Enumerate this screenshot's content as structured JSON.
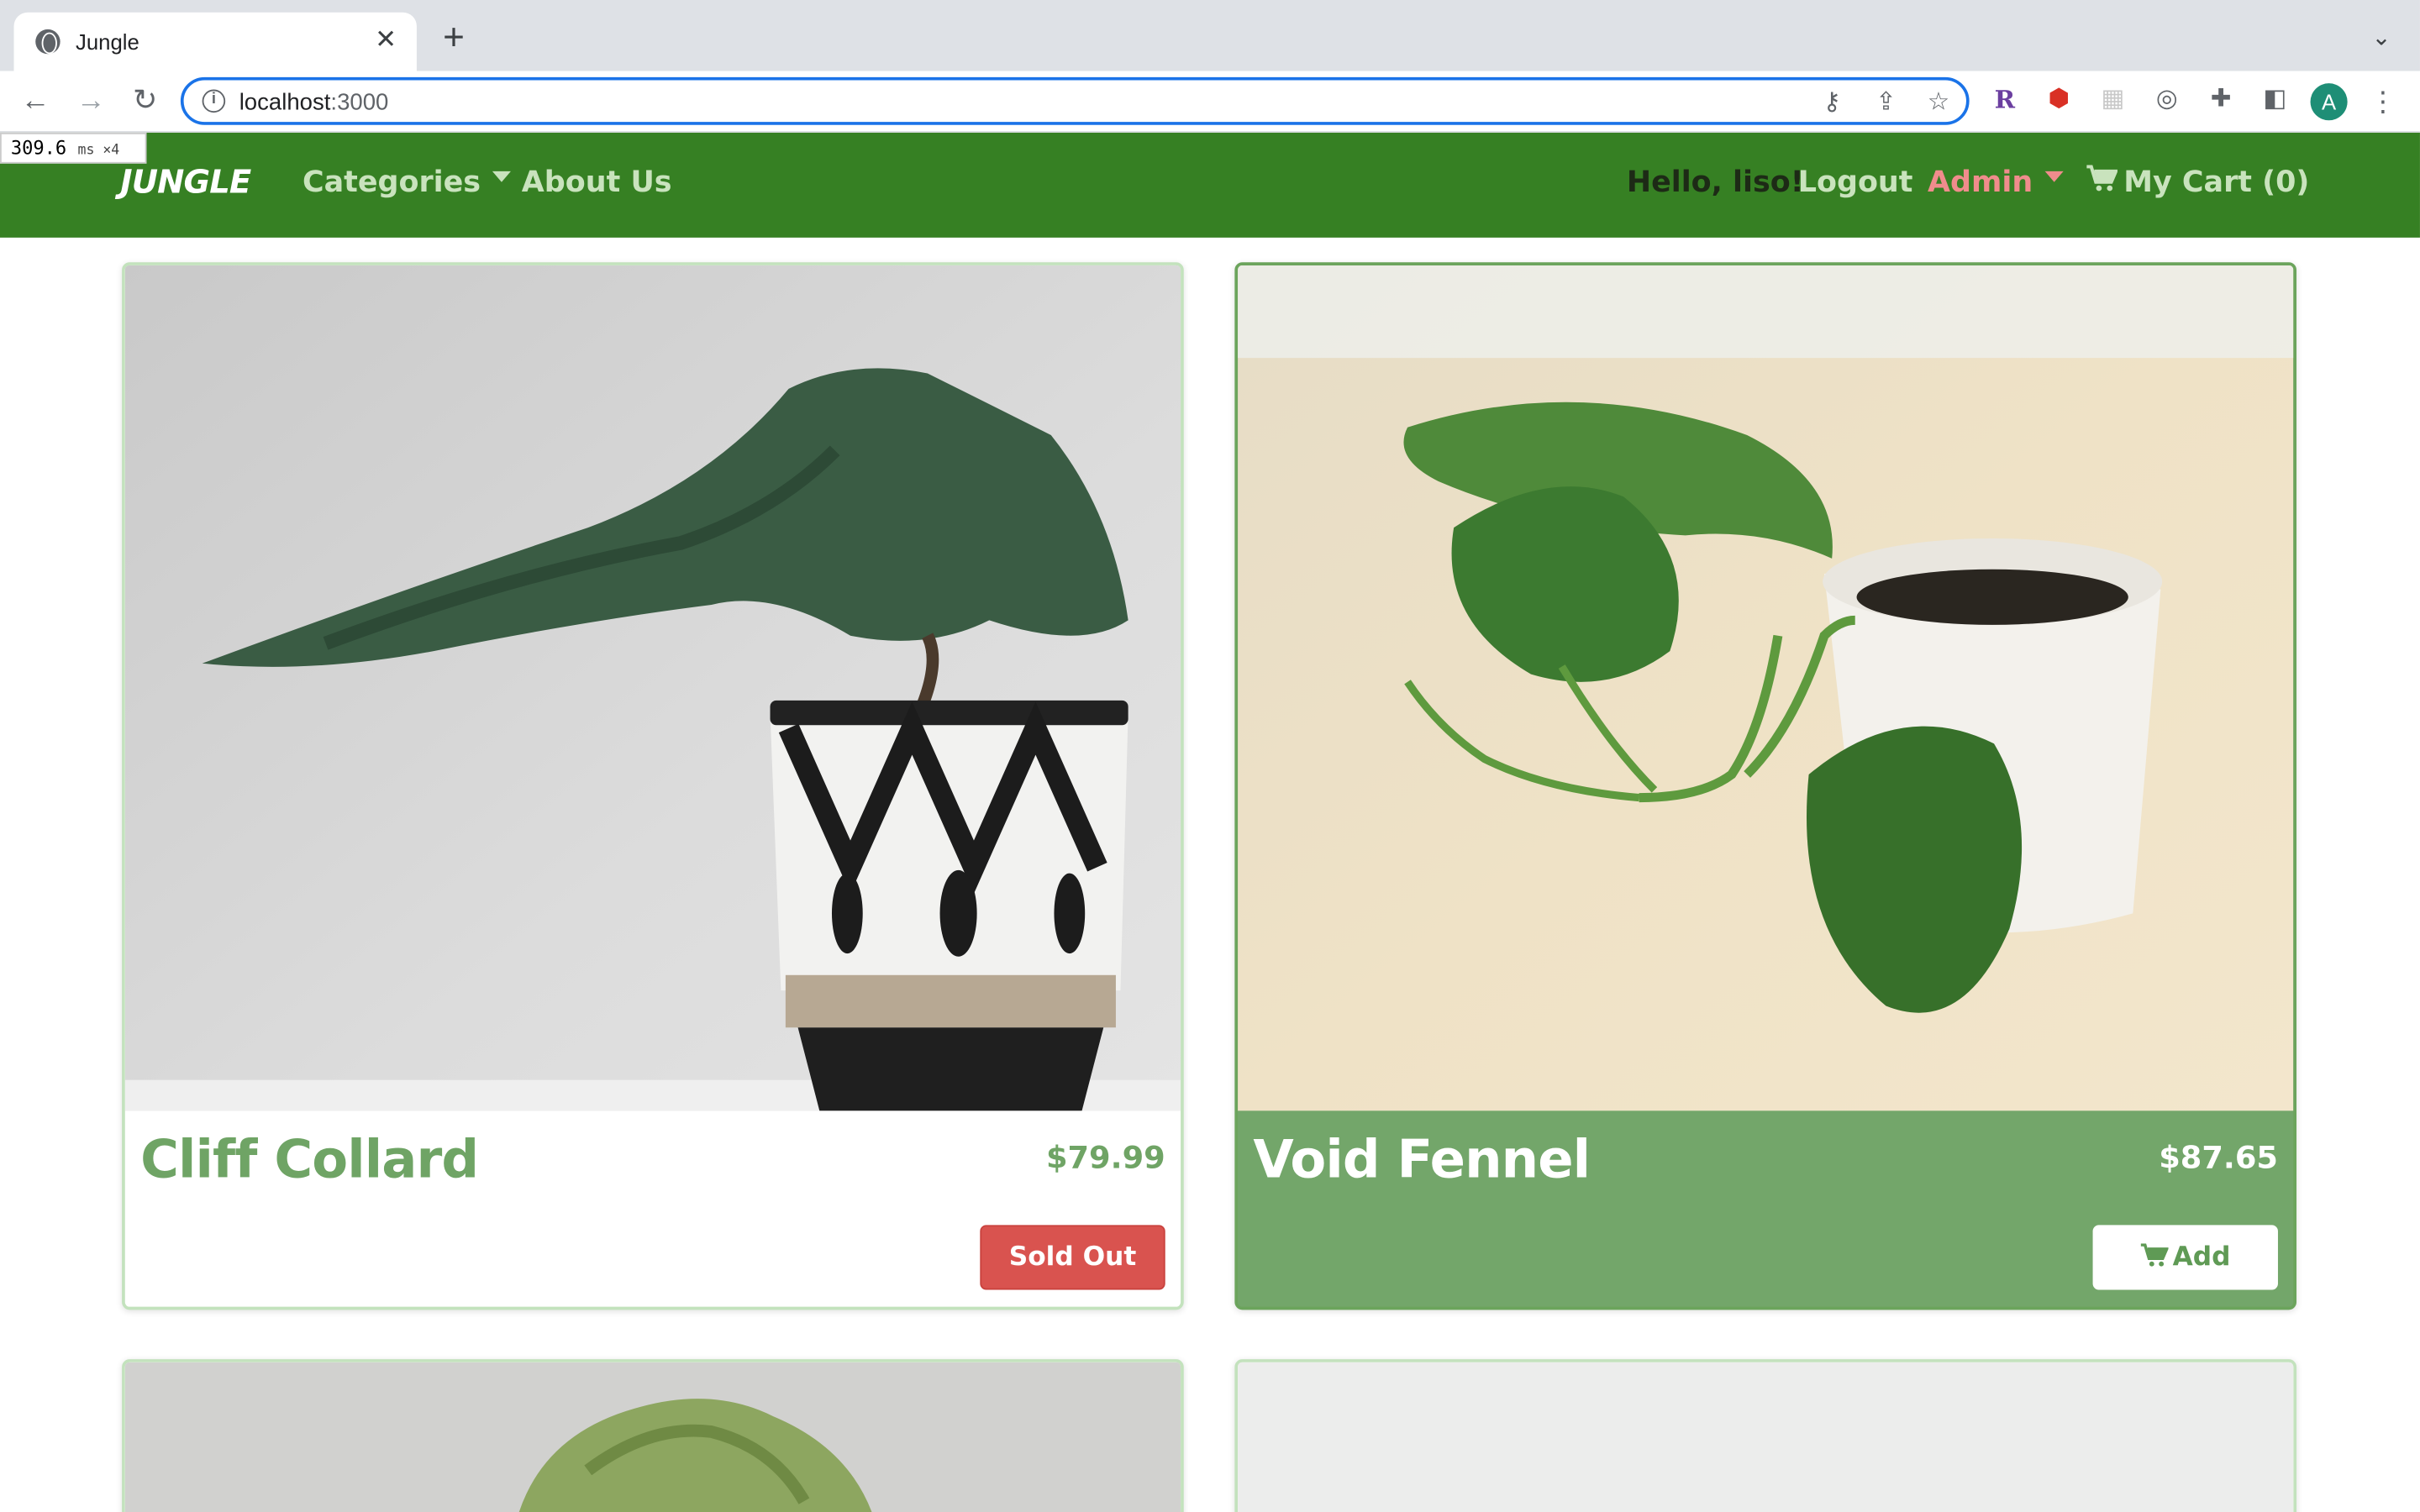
{
  "browser": {
    "tab_title": "Jungle",
    "url_host": "localhost",
    "url_port": ":3000",
    "perf_value": "309.6",
    "perf_unit": "ms ×4"
  },
  "navbar": {
    "brand": "JUNGLE",
    "categories": "Categories",
    "about": "About Us",
    "hello": "Hello, liso!",
    "logout": "Logout",
    "admin": "Admin",
    "cart": "My Cart (0)"
  },
  "products": [
    {
      "name": "Cliff Collard",
      "price": "$79.99",
      "action": "Sold Out"
    },
    {
      "name": "Void Fennel",
      "price": "$87.65",
      "action": "Add"
    }
  ],
  "colors": {
    "navbar_bg": "#368023",
    "product_text": "#6fa465",
    "sold_out_bg": "#d9534f",
    "hover_card_bg": "#73a66a"
  }
}
